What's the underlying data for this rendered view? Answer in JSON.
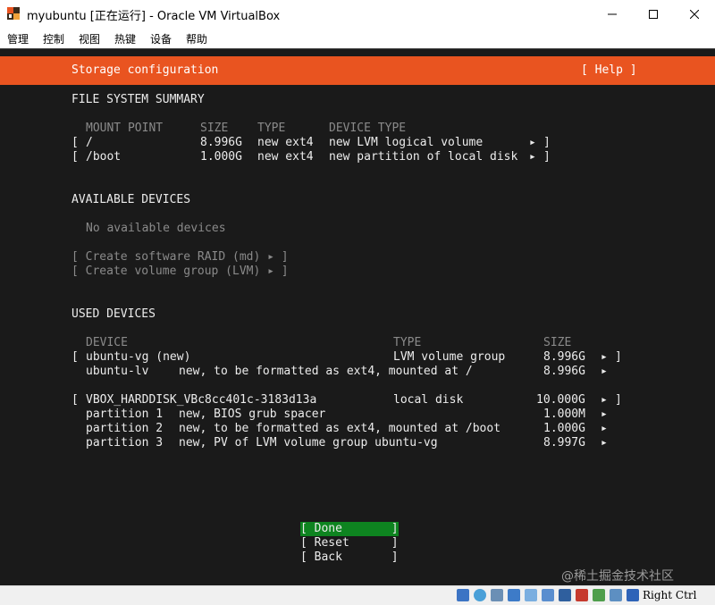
{
  "window": {
    "title": "myubuntu [正在运行] - Oracle VM VirtualBox"
  },
  "menu": [
    "管理",
    "控制",
    "视图",
    "热键",
    "设备",
    "帮助"
  ],
  "installer": {
    "header_title": "Storage configuration",
    "help_button": "[ Help ]",
    "fs_summary_heading": "FILE SYSTEM SUMMARY",
    "fs_columns": {
      "mount_point": "MOUNT POINT",
      "size": "SIZE",
      "type": "TYPE",
      "device_type": "DEVICE TYPE"
    },
    "fs_rows": [
      {
        "open": "[",
        "mount": "/",
        "size": "8.996G",
        "type": "new ext4",
        "device_type": "new LVM logical volume",
        "arrow": "▸",
        "close": "]"
      },
      {
        "open": "[",
        "mount": "/boot",
        "size": "1.000G",
        "type": "new ext4",
        "device_type": "new partition of local disk",
        "arrow": "▸",
        "close": "]"
      }
    ],
    "available_heading": "AVAILABLE DEVICES",
    "no_available": "No available devices",
    "create_raid": "[ Create software RAID (md) ▸ ]",
    "create_vg": "[ Create volume group (LVM) ▸ ]",
    "used_heading": "USED DEVICES",
    "used_columns": {
      "device": "DEVICE",
      "type": "TYPE",
      "size": "SIZE"
    },
    "vg": {
      "open": "[",
      "name": "ubuntu-vg (new)",
      "type": "LVM volume group",
      "size": "8.996G",
      "arrow": "▸",
      "close": "]",
      "lv_name": "ubuntu-lv",
      "lv_desc": "new, to be formatted as ext4, mounted at /",
      "lv_size": "8.996G",
      "lv_arrow": "▸"
    },
    "disk": {
      "open": "[",
      "name": "VBOX_HARDDISK_VBc8cc401c-3183d13a",
      "type": "local disk",
      "size": "10.000G",
      "arrow": "▸",
      "close": "]",
      "partitions": [
        {
          "label": "partition 1",
          "desc": "new, BIOS grub spacer",
          "size": "1.000M",
          "arrow": "▸"
        },
        {
          "label": "partition 2",
          "desc": "new, to be formatted as ext4, mounted at /boot",
          "size": "1.000G",
          "arrow": "▸"
        },
        {
          "label": "partition 3",
          "desc": "new, PV of LVM volume group ubuntu-vg",
          "size": "8.997G",
          "arrow": "▸"
        }
      ]
    },
    "buttons": {
      "done": "[ Done       ]",
      "reset": "[ Reset      ]",
      "back": "[ Back       ]"
    }
  },
  "statusbar": {
    "host_key": "Right Ctrl"
  },
  "watermark": "@稀土掘金技术社区",
  "colors": {
    "header": "#e95420",
    "selected_button": "#0e8420",
    "terminal_bg": "#1a1a1a"
  },
  "icons": [
    "app-icon",
    "minimize-icon",
    "maximize-icon",
    "close-icon",
    "hdd-icon",
    "optical-icon",
    "usb-icon",
    "network-icon",
    "shared-folder-icon",
    "display-icon",
    "video-capture-icon",
    "record-icon",
    "cpu-icon",
    "mouse-icon",
    "keyboard-down-icon"
  ]
}
